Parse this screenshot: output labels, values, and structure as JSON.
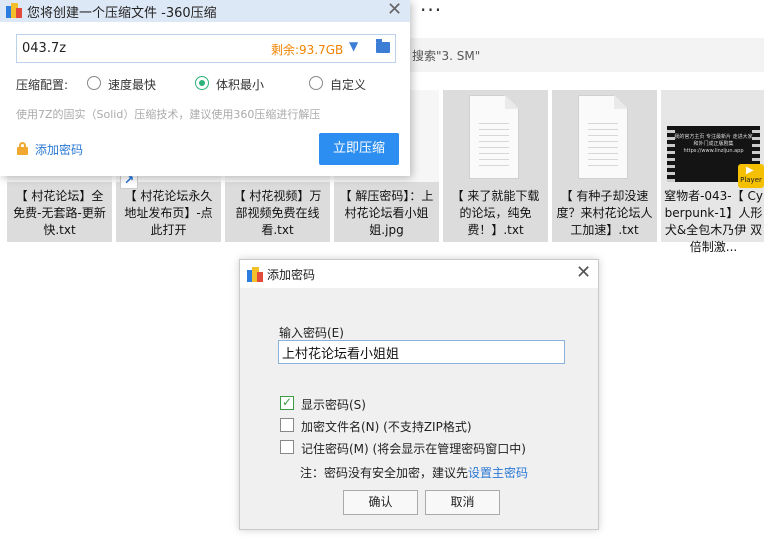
{
  "explorer": {
    "ellipsis": "...",
    "search_text": "搜索\"3. SM\"",
    "tiles": [
      {
        "label": "【 村花论坛】全免费-无套路-更新快.txt"
      },
      {
        "label": "【 村花论坛永久地址发布页】-点此打开"
      },
      {
        "label": "【 村花视频】万部视频免费在线看.txt"
      },
      {
        "label": "【 解压密码】：上村花论坛看小姐姐.jpg"
      },
      {
        "label": "【 来了就能下载的论坛，纯免费！】.txt"
      },
      {
        "label": "【 有种子却没速度？来村花论坛人工加速】.txt"
      },
      {
        "label": "窒物者-043-【 Cyberpunk-1】人形犬&全包木乃伊 双倍制激..."
      }
    ],
    "video_thumb_text": "我的官方主页 专注最新片 走进大家和外门成正版剧集 https://www.linzijun.app",
    "player_badge": "Player"
  },
  "compress_dialog": {
    "title": "您将创建一个压缩文件 -360压缩",
    "path_value": "043.7z",
    "free_space": "剩余:93.7GB",
    "config_label": "压缩配置:",
    "options": [
      {
        "label": "速度最快",
        "selected": false
      },
      {
        "label": "体积最小",
        "selected": true
      },
      {
        "label": "自定义",
        "selected": false
      }
    ],
    "hint": "使用7Z的固实（Solid）压缩技术，建议使用360压缩进行解压",
    "add_password": "添加密码",
    "compress_button": "立即压缩"
  },
  "password_dialog": {
    "title": "添加密码",
    "input_label": "输入密码(E)",
    "password_value": "上村花论坛看小姐姐",
    "checkboxes": [
      {
        "label": "显示密码(S)",
        "checked": true
      },
      {
        "label": "加密文件名(N) (不支持ZIP格式)",
        "checked": false
      },
      {
        "label": "记住密码(M) (将会显示在管理密码窗口中)",
        "checked": false
      }
    ],
    "note_prefix": "注：密码没有安全加密，建议先",
    "note_link": "设置主密码",
    "ok_button": "确认",
    "cancel_button": "取消"
  },
  "colors": {
    "accent_blue": "#2b8ef0",
    "free_space_orange": "#f08300",
    "link_blue": "#2a78d4",
    "radio_green": "#2bb27a"
  }
}
